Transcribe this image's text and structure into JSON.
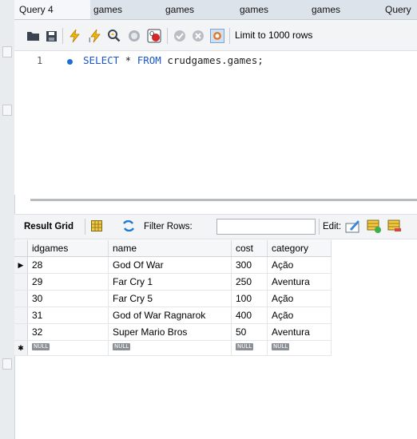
{
  "tabs": [
    "Query 4",
    "games",
    "games",
    "games",
    "games",
    "Query"
  ],
  "toolbar": {
    "limit_label": "Limit to 1000 rows",
    "icons": [
      "folder-open-icon",
      "save-icon",
      "execute-icon",
      "execute-selection-icon",
      "explain-icon",
      "stop-icon",
      "toggle-error-icon",
      "commit-icon",
      "rollback-icon",
      "autocommit-icon"
    ]
  },
  "editor": {
    "line_number": "1",
    "query_keyword1": "SELECT",
    "query_star": " * ",
    "query_keyword2": "FROM",
    "query_rest": " crudgames.games;"
  },
  "result_toolbar": {
    "result_grid_label": "Result Grid",
    "filter_label": "Filter Rows:",
    "edit_label": "Edit:"
  },
  "grid": {
    "columns": [
      "idgames",
      "name",
      "cost",
      "category"
    ],
    "rows": [
      [
        "28",
        "God Of War",
        "300",
        "Ação"
      ],
      [
        "29",
        "Far Cry 1",
        "250",
        "Aventura"
      ],
      [
        "30",
        "Far Cry 5",
        "100",
        "Ação"
      ],
      [
        "31",
        "God of War Ragnarok",
        "400",
        "Ação"
      ],
      [
        "32",
        "Super Mario Bros",
        "50",
        "Aventura"
      ]
    ],
    "null_label": "NULL",
    "current_row_marker": "▶",
    "new_row_marker": "✱"
  }
}
